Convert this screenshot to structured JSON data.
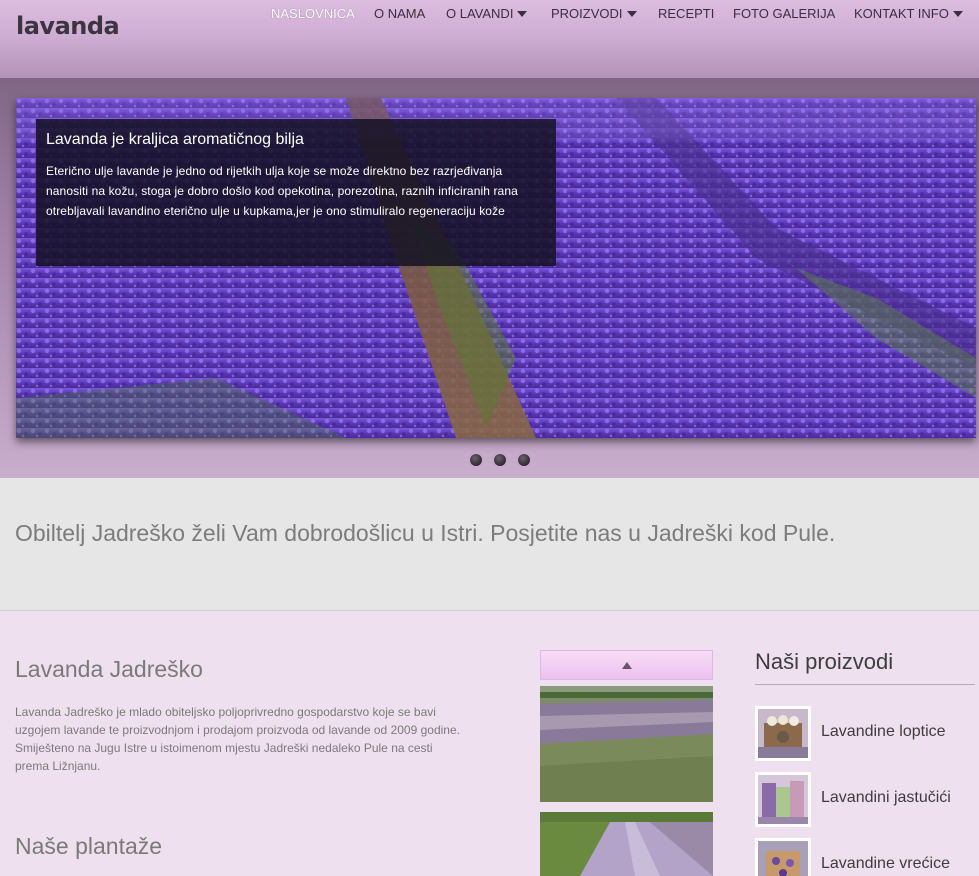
{
  "brand": {
    "logo": "lavanda"
  },
  "nav": [
    {
      "label": "NASLOVNICA",
      "active": true,
      "dropdown": false
    },
    {
      "label": "O NAMA",
      "active": false,
      "dropdown": false
    },
    {
      "label": "O LAVANDI",
      "active": false,
      "dropdown": true
    },
    {
      "label": "PROIZVODI",
      "active": false,
      "dropdown": true
    },
    {
      "label": "RECEPTI",
      "active": false,
      "dropdown": false
    },
    {
      "label": "FOTO GALERIJA",
      "active": false,
      "dropdown": false
    },
    {
      "label": "KONTAKT INFO",
      "active": false,
      "dropdown": true
    }
  ],
  "slider": {
    "caption_title": "Lavanda je kraljica aromatičnog bilja",
    "caption_text": "Eterično ulje lavande je jedno od rijetkih ulja koje se može direktno bez razrjeđivanja nanositi na kožu, stoga je dobro došlo kod opekotina, porezotina, raznih inficiranih rana otrebljavali lavandino eterično ulje u kupkama,jer je ono stimuliralo regeneraciju kože",
    "slide_count": 3,
    "active_slide": 1
  },
  "welcome": {
    "text": "Obiltelj Jadreško želi Vam dobrodošlicu u Istri. Posjetite nas u Jadreški kod Pule."
  },
  "about": {
    "title": "Lavanda Jadreško",
    "paragraphs": [
      "Lavanda Jadreško je mlado obiteljsko poljoprivredno gospodarstvo koje se bavi uzgojem lavande te proizvodnjom i prodajom proizvoda od lavande od 2009 godine.",
      "Smiješteno na Jugu Istre u istoimenom mjestu Jadreški nedaleko Pule na cesti prema Ližnjanu."
    ]
  },
  "plantations": {
    "title": "Naše plantaže"
  },
  "gallery": {
    "up_icon": "triangle-up-icon"
  },
  "products": {
    "title": "Naši proizvodi",
    "items": [
      {
        "name": "Lavandine loptice"
      },
      {
        "name": "Lavandini jastučići"
      },
      {
        "name": "Lavandine vrećice"
      }
    ]
  },
  "colors": {
    "header_top": "#dcbcdf",
    "content_bg": "#efe0ef",
    "welcome_bg": "#e6e6e6",
    "lavender": "#6a45c0"
  }
}
